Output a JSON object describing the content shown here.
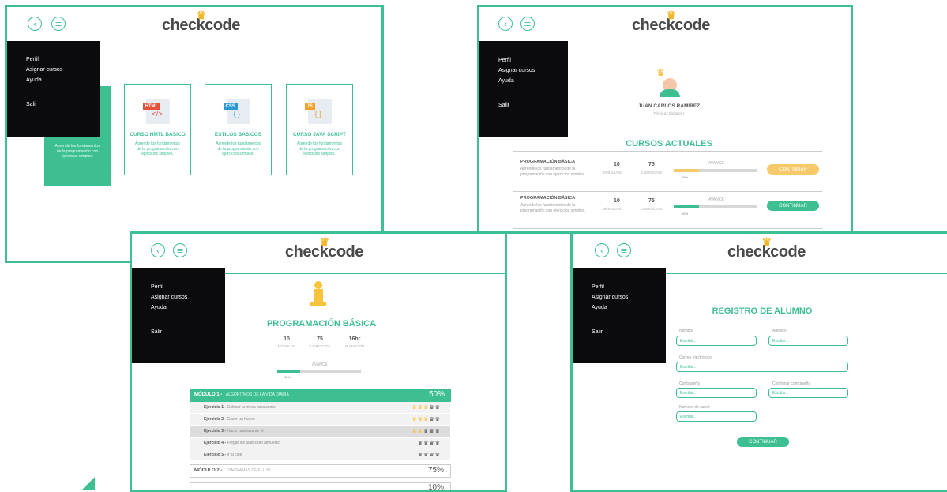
{
  "brand": {
    "logo_text": "checkcode",
    "accent": "#3dbf91",
    "accent_orange": "#f6c96a",
    "sidebar_bg": "#0b0b0e"
  },
  "header": {
    "back_icon": "chevron-left-icon",
    "menu_icon": "menu-icon"
  },
  "sidebar": {
    "items": [
      "Perfil",
      "Asignar cursos",
      "Ayuda",
      "Salir"
    ]
  },
  "courses_screen": {
    "cards": [
      {
        "tag": "",
        "title": "",
        "desc": "Aprende los fundamentos de la programación con ejercicios simples."
      },
      {
        "tag": "HTML",
        "title": "CURSO HMTL BÁSICO",
        "desc": "Aprende los fundamentos de la programación con ejercicios simples."
      },
      {
        "tag": "CSS",
        "title": "ESTILOS BASICOS",
        "desc": "Aprende los fundamentos de la programación con ejercicios simples."
      },
      {
        "tag": "JS",
        "title": "CURSO JAVA SCRIPT",
        "desc": "Aprende los fundamentos de la programación con ejercicios simples."
      }
    ]
  },
  "profile_screen": {
    "name": "JUAN CARLOS  RAMIREZ",
    "subtitle": "Técnicas Digitales I",
    "section_title": "CURSOS ACTUALES",
    "courses": [
      {
        "title": "PROGRAMACIÓN BÁSICA",
        "desc": "Aprende los fundamentos de la programación con ejercicios simples.",
        "modules": "10",
        "modules_label": "MÓDULOS",
        "exercises": "75",
        "exercises_label": "EJERCICIOS",
        "progress_label": "AVANCE",
        "progress": "10%",
        "progress_value": 0.3,
        "button": "CONTINUAR",
        "button_style": "orange"
      },
      {
        "title": "PROGRAMACIÓN BÁSICA",
        "desc": "Aprende los fundamentos de la programación con ejercicios simples.",
        "modules": "10",
        "modules_label": "MÓDULOS",
        "exercises": "75",
        "exercises_label": "EJERCICIOS",
        "progress_label": "AVANCE",
        "progress": "10%",
        "progress_value": 0.3,
        "button": "CONTINUAR",
        "button_style": "green"
      }
    ]
  },
  "course_screen": {
    "title": "PROGRAMACIÓN BÁSICA",
    "stats": [
      {
        "value": "10",
        "label": "MÓDULOS"
      },
      {
        "value": "75",
        "label": "EJERCICIOS"
      },
      {
        "value": "16hr",
        "label": "DURACIÓN"
      }
    ],
    "progress_label": "AVANCE",
    "progress": "10%",
    "progress_value": 0.27,
    "module1": {
      "name": "MÓDULO 1 -",
      "topic": "ALGORITMOS DE LA VIDA DIARIA",
      "percent": "50%"
    },
    "exercises": [
      {
        "name": "Ejercicio 1 -",
        "desc": "Colocar la mesa para comer",
        "stars": 3
      },
      {
        "name": "Ejercicio 2 -",
        "desc": "Cocer un huevo",
        "stars": 2
      },
      {
        "name": "Ejercicio 3 -",
        "desc": "Hacer una taza de té",
        "stars": 2
      },
      {
        "name": "Ejercicio 4 -",
        "desc": "Fregar los platos del almuerzo",
        "stars": 0
      },
      {
        "name": "Ejercicio 5 -",
        "desc": "Ir al cine",
        "stars": 0
      }
    ],
    "module2": {
      "name": "MÓDULO 2 -",
      "topic": "DIAGRAMAS DE FLUJO",
      "percent": "75%"
    },
    "module3": {
      "percent": "10%"
    }
  },
  "register_screen": {
    "title": "REGISTRO DE ALUMNO",
    "fields": {
      "nombre": "Nombre",
      "apellido": "Apellido",
      "correo": "Correo electrónico",
      "contrasena": "Contraseña",
      "confirmar": "Confirmar  contraseña",
      "carne": "Número de carné"
    },
    "placeholder": "Escribir...",
    "button": "CONTINUAR"
  }
}
